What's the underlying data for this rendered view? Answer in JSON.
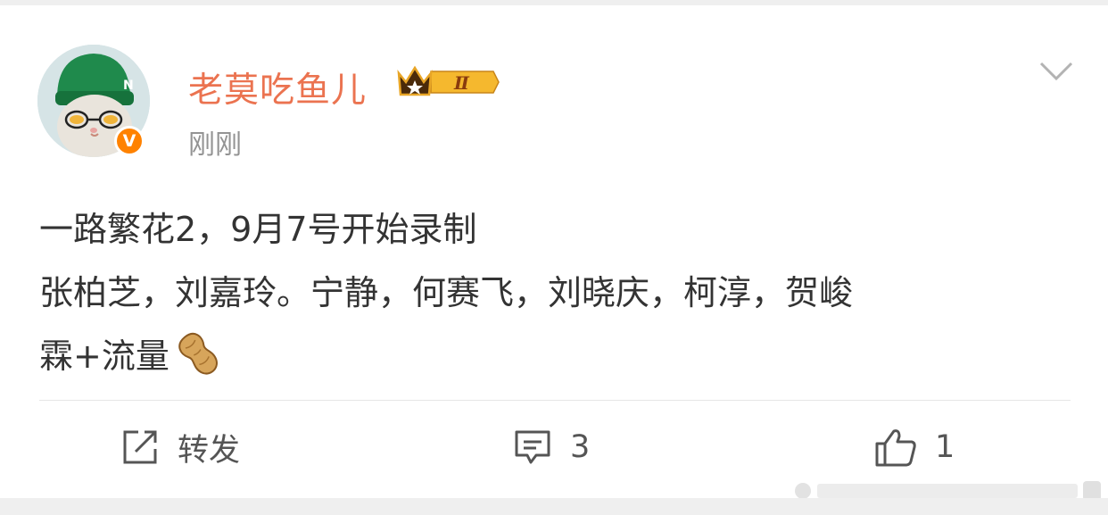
{
  "post": {
    "username": "老莫吃鱼儿",
    "level_badge": "Ⅱ",
    "verified_mark": "V",
    "timestamp": "刚刚",
    "content_lines": [
      "一路繁花2，9月7号开始录制",
      "张柏芝，刘嘉玲。宁静，何赛飞，刘晓庆，柯淳，贺峻",
      "霖+流量"
    ],
    "content_emoji": "peanut-emoji"
  },
  "actions": {
    "repost_label": "转发",
    "comment_count": "3",
    "like_count": "1"
  },
  "icons": {
    "more": "chevron-down-icon",
    "repost": "share-edit-icon",
    "comment": "comment-bubble-icon",
    "like": "thumbs-up-icon",
    "crown": "crown-icon"
  },
  "colors": {
    "username": "#eb7350",
    "verified_badge": "#ff8200",
    "timestamp": "#939393",
    "text": "#333333",
    "background": "#ffffff"
  }
}
